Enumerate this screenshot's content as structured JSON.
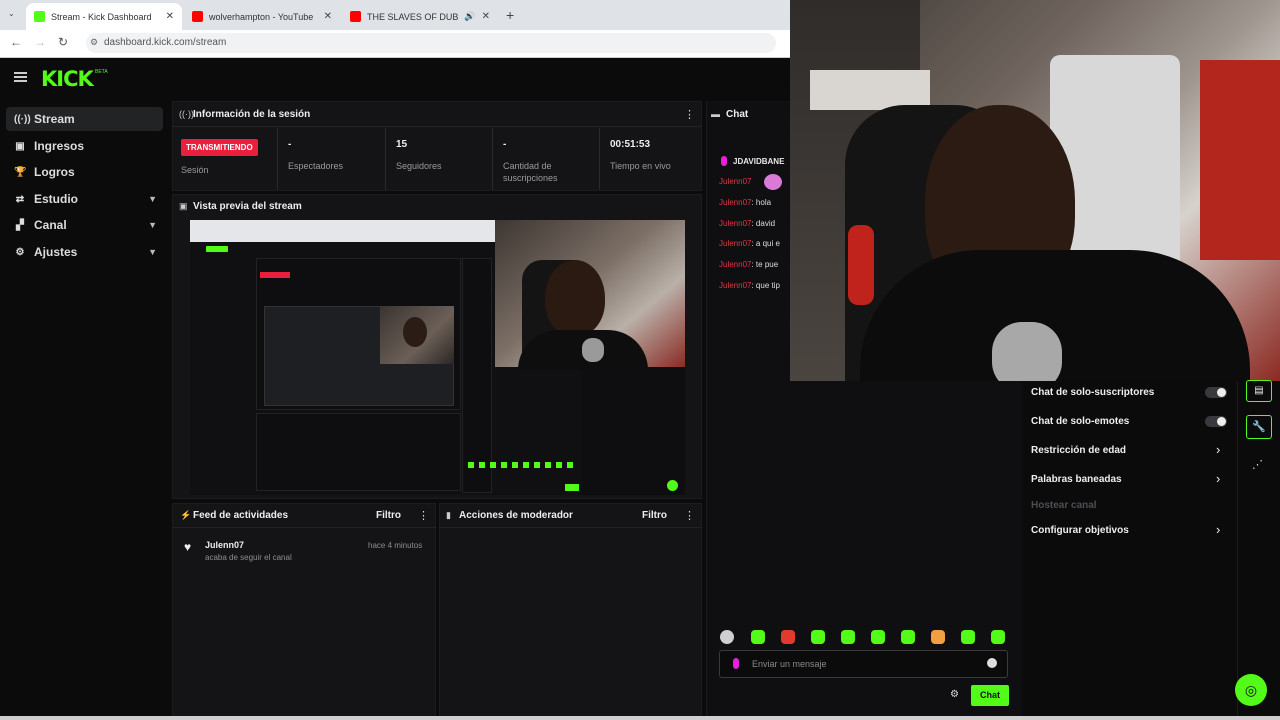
{
  "browser": {
    "tabs": [
      {
        "title": "Stream - Kick Dashboard",
        "fav_color": "#53fc18"
      },
      {
        "title": "wolverhampton - YouTube",
        "fav_color": "#ff0000"
      },
      {
        "title": "THE SLAVES OF DUBAI (if th",
        "fav_color": "#ff0000"
      }
    ],
    "new_tab": "+",
    "url": "dashboard.kick.com/stream"
  },
  "app": {
    "logo": "KICK",
    "beta": "BETA",
    "accent": "#53fc18"
  },
  "sidebar": {
    "items": [
      {
        "label": "Stream",
        "icon": "stream-icon"
      },
      {
        "label": "Ingresos",
        "icon": "money-icon"
      },
      {
        "label": "Logros",
        "icon": "trophy-icon"
      },
      {
        "label": "Estudio",
        "icon": "studio-icon"
      },
      {
        "label": "Canal",
        "icon": "channel-icon"
      },
      {
        "label": "Ajustes",
        "icon": "gear-icon"
      }
    ]
  },
  "session": {
    "title": "Información de la sesión",
    "badge": "TRANSMITIENDO",
    "session_label": "Sesión",
    "stats": [
      {
        "value": "-",
        "label": "Espectadores"
      },
      {
        "value": "15",
        "label": "Seguidores"
      },
      {
        "value": "-",
        "label": "Cantidad de suscripciones"
      },
      {
        "value": "00:51:53",
        "label": "Tiempo en vivo"
      }
    ]
  },
  "preview": {
    "title": "Vista previa del stream"
  },
  "feed": {
    "title": "Feed de actividades",
    "filter": "Filtro",
    "items": [
      {
        "user": "Julenn07",
        "text": "acaba de seguir el canal",
        "time": "hace 4 minutos"
      }
    ]
  },
  "mod": {
    "title": "Acciones de moderador",
    "filter": "Filtro"
  },
  "chat": {
    "title": "Chat",
    "pinned_user": "JDAVIDBANE",
    "messages": [
      {
        "user": "Julenn07",
        "text": ""
      },
      {
        "user": "Julenn07",
        "text": ": hola"
      },
      {
        "user": "Julenn07",
        "text": ": david"
      },
      {
        "user": "Julenn07",
        "text": ": a qui e"
      },
      {
        "user": "Julenn07",
        "text": ": te pue"
      },
      {
        "user": "Julenn07",
        "text": ": que tip"
      }
    ],
    "input_placeholder": "Enviar un mensaje",
    "send_label": "Chat"
  },
  "chat_settings": {
    "items": [
      {
        "label": "Chat de solo-suscriptores",
        "control": "toggle"
      },
      {
        "label": "Chat de solo-emotes",
        "control": "toggle"
      },
      {
        "label": "Restricción de edad",
        "control": "chevron"
      },
      {
        "label": "Palabras baneadas",
        "control": "chevron"
      },
      {
        "label": "Hostear canal",
        "control": "disabled"
      },
      {
        "label": "Configurar objetivos",
        "control": "chevron"
      }
    ]
  }
}
